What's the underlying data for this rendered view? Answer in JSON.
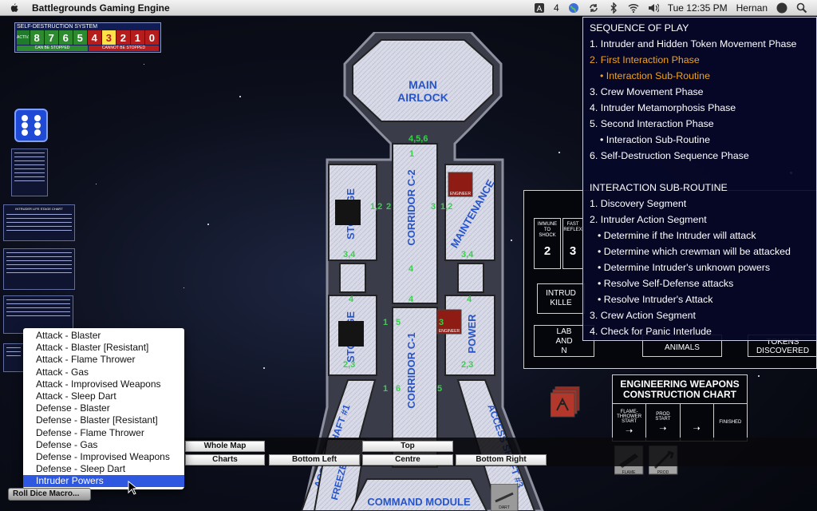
{
  "menubar": {
    "app_title": "Battlegrounds Gaming Engine",
    "status_count": "4",
    "clock": "Tue 12:35 PM",
    "user": "Hernan"
  },
  "self_destruct": {
    "title": "SELF-DESTRUCTION SYSTEM",
    "activate_label": "ACTIV.",
    "numbers": [
      "8",
      "7",
      "6",
      "5",
      "4",
      "3",
      "2",
      "1",
      "0"
    ],
    "highlighted": "3",
    "can_stop_label": "CAN BE STOPPED",
    "cannot_stop_label": "CANNOT BE STOPPED"
  },
  "thumbnails": {
    "life_stage_title": "INTRUDER LIFE STAGE CHART"
  },
  "ship": {
    "main_airlock": [
      "MAIN",
      "AIRLOCK"
    ],
    "storage_upper": "STORAGE",
    "storage_lower": "STORAGE",
    "corridor_c2": "CORRIDOR C-2",
    "corridor_c1": "CORRIDOR C-1",
    "maintenance": "MAINTENANCE",
    "power": "POWER",
    "access_shaft_1": "ACCESS SHAFT #1",
    "access_shaft_3": "ACCESS SHAFT #3",
    "freezer": "FREEZER",
    "command_module": "COMMAND MODULE",
    "connections": {
      "top": "4,5,6",
      "n1": "1",
      "n12": "1,2",
      "n12b": "1,2",
      "n3": "3",
      "n2": "2",
      "n34a": "3,4",
      "n34b": "3,4",
      "n4a": "4",
      "n4b": "4",
      "n4c": "4",
      "n4d": "4",
      "n1b": "1",
      "n5": "5",
      "n3b": "3",
      "n23a": "2,3",
      "n23b": "2,3",
      "n1c": "1",
      "n6": "6",
      "n5b": "5"
    },
    "crew_tokens": [
      "ENGINEER",
      "ENGINEER"
    ]
  },
  "sequence": {
    "title": "SEQUENCE OF PLAY",
    "items": [
      "1. Intruder and Hidden Token Movement Phase",
      "2. First Interaction Phase",
      "• Interaction Sub-Routine",
      "3. Crew Movement Phase",
      "4. Intruder Metamorphosis Phase",
      "5. Second Interaction Phase",
      "• Interaction Sub-Routine",
      "6. Self-Destruction Sequence Phase"
    ],
    "sub_title": "INTERACTION SUB-ROUTINE",
    "sub_items": [
      "1. Discovery Segment",
      "2. Intruder Action Segment",
      "• Determine if the Intruder will attack",
      "• Determine which crewman will be attacked",
      "• Determine Intruder's unknown powers",
      "• Resolve Self-Defense attacks",
      "• Resolve Intruder's Attack",
      "3. Crew Action Segment",
      "4. Check for Panic Interlude"
    ],
    "highlight_color": "#f2a21c"
  },
  "status_table": {
    "immune_label": [
      "IMMUNE",
      "TO",
      "SHOCK"
    ],
    "fast_label": [
      "FAST",
      "REFLEX"
    ],
    "val1": "2",
    "val2": "3",
    "intruder_killed": [
      "INTRUD",
      "KILLE"
    ],
    "label_and": [
      "LAB",
      "AND",
      "N"
    ],
    "animals": "ANIMALS",
    "tokens_discovered": [
      "TOKENS",
      "DISCOVERED"
    ]
  },
  "engineering": {
    "title": [
      "ENGINEERING WEAPONS",
      "CONSTRUCTION CHART"
    ],
    "flame_start": [
      "FLAME-",
      "THROWER",
      "START"
    ],
    "prod_start": [
      "PROD",
      "START"
    ],
    "finished": "FINISHED",
    "token_labels": [
      "FLAME",
      "PROD"
    ]
  },
  "zoom": {
    "whole_map": "Whole Map",
    "charts": "Charts",
    "top": "Top",
    "bottom_left": "Bottom Left",
    "centre": "Centre",
    "bottom_right": "Bottom Right"
  },
  "dice_menu": {
    "items": [
      "Attack - Blaster",
      "Attack - Blaster [Resistant]",
      "Attack - Flame Thrower",
      "Attack - Gas",
      "Attack - Improvised Weapons",
      "Attack - Sleep Dart",
      "Defense - Blaster",
      "Defense - Blaster [Resistant]",
      "Defense - Flame Thrower",
      "Defense - Gas",
      "Defense - Improvised Weapons",
      "Defense - Sleep Dart",
      "Intruder Powers"
    ],
    "selected": "Intruder Powers",
    "roll_button": "Roll Dice Macro...",
    "selection_color": "#2f58e0"
  },
  "map_tokens": [
    "DART"
  ]
}
